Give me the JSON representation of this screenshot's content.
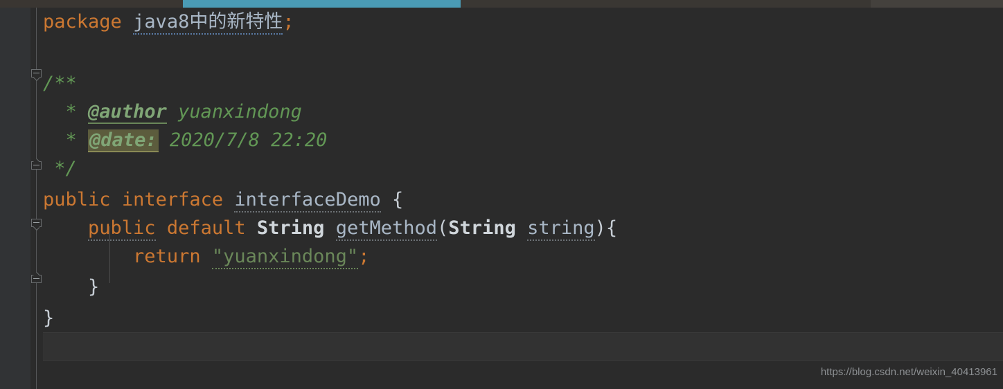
{
  "app": {
    "theme": "darcula",
    "colors": {
      "editor_background": "#2b2b2b",
      "gutter_background": "#313335",
      "tab_active_accent": "#4a9bb5",
      "keyword": "#cc7832",
      "identifier": "#a9b7c6",
      "string": "#6a8759",
      "comment": "#629755",
      "doc_tag_highlight": "#5c5c3d",
      "caret_line": "#323232"
    }
  },
  "tab_bar": {
    "active_tab_underline_visible": "true"
  },
  "gutter": {
    "fold_markers": [
      {
        "name": "fold-javadoc-start",
        "state": "expanded",
        "glyph": "−"
      },
      {
        "name": "fold-javadoc-end",
        "state": "expanded",
        "glyph": "−"
      },
      {
        "name": "fold-method-start",
        "state": "expanded",
        "glyph": "−"
      },
      {
        "name": "fold-method-end",
        "state": "expanded",
        "glyph": "−"
      }
    ]
  },
  "code": {
    "language": "Java",
    "lines": {
      "package_keyword": "package",
      "package_name": "java8中的新特性",
      "package_semicolon": ";",
      "javadoc_open": "/**",
      "javadoc_star_1": "*",
      "javadoc_tag_author": "@author",
      "javadoc_author_value": "yuanxindong",
      "javadoc_star_2": "*",
      "javadoc_tag_date": "@date:",
      "javadoc_date_value": "2020/7/8 22:20",
      "javadoc_close": "*/",
      "decl_public": "public",
      "decl_interface": "interface",
      "decl_name": "interfaceDemo",
      "decl_brace": "{",
      "method_public": "public",
      "method_default": "default",
      "method_return_type": "String",
      "method_name": "getMethod",
      "method_paren_open": "(",
      "method_param_type": "String",
      "method_param_name": "string",
      "method_paren_close": ")",
      "method_brace": "{",
      "return_keyword": "return",
      "return_value": "\"yuanxindong\"",
      "return_semicolon": ";",
      "method_close_brace": "}",
      "interface_close_brace": "}"
    }
  },
  "watermark": {
    "url": "https://blog.csdn.net/weixin_40413961"
  }
}
